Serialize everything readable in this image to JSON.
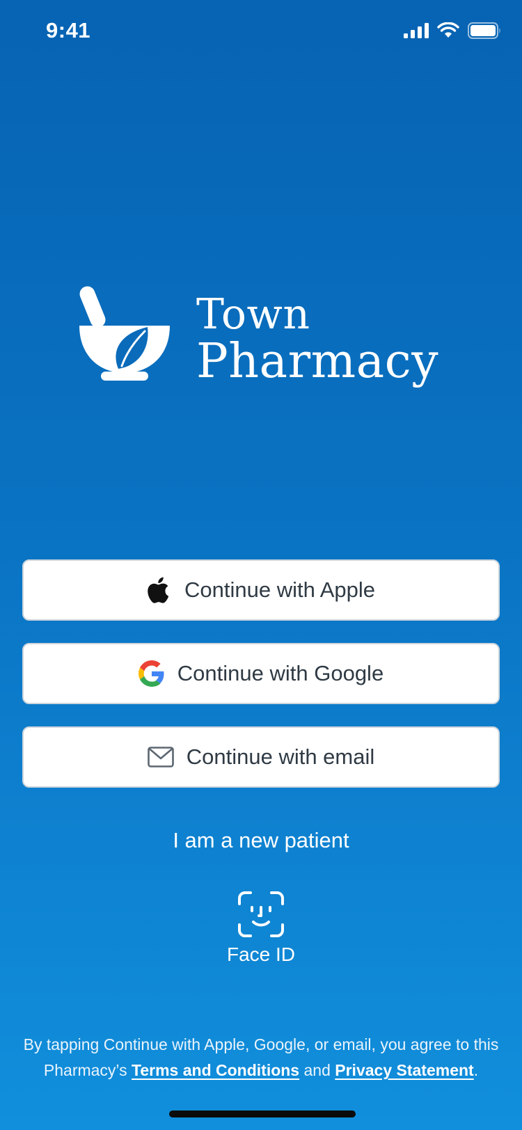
{
  "status_bar": {
    "time": "9:41",
    "icons": [
      "cellular-signal-icon",
      "wifi-icon",
      "battery-icon"
    ]
  },
  "logo": {
    "line1": "Town",
    "line2": "Pharmacy",
    "icon": "mortar-pestle-leaf-icon"
  },
  "auth": {
    "apple_label": "Continue with Apple",
    "google_label": "Continue with Google",
    "email_label": "Continue with email"
  },
  "new_patient_label": "I am a new patient",
  "face_id": {
    "label": "Face ID",
    "icon": "face-id-icon"
  },
  "legal": {
    "prefix": "By tapping Continue with Apple, Google, or email, you agree to this Pharmacy’s",
    "terms_link": "Terms and Conditions",
    "conjunction": "and",
    "privacy_link": "Privacy Statement",
    "suffix": "."
  },
  "colors": {
    "background_top": "#0763b3",
    "background_bottom": "#118fdc",
    "button_bg": "#ffffff",
    "button_text": "#2f3a44",
    "google_blue": "#4285F4",
    "google_red": "#EA4335",
    "google_yellow": "#FBBC05",
    "google_green": "#34A853"
  }
}
